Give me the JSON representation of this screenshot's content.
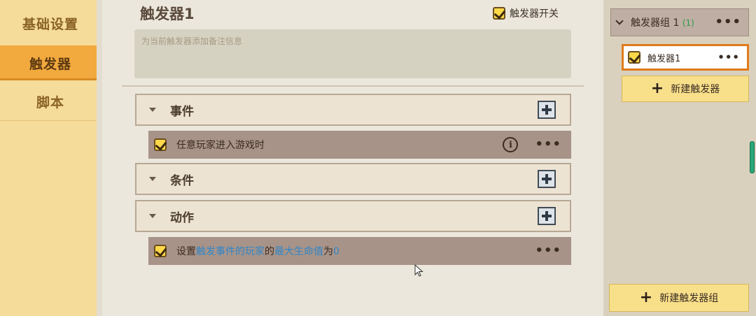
{
  "left_nav": {
    "items": [
      {
        "label": "基础设置",
        "active": false
      },
      {
        "label": "触发器",
        "active": true
      },
      {
        "label": "脚本",
        "active": false
      }
    ]
  },
  "editor": {
    "title": "触发器1",
    "switch_label": "触发器开关",
    "switch_checked": true,
    "note_placeholder": "为当前触发器添加备注信息",
    "sections": {
      "events": {
        "label": "事件"
      },
      "conditions": {
        "label": "条件"
      },
      "actions": {
        "label": "动作"
      }
    },
    "event_item": {
      "text": "任意玩家进入游戏时",
      "checked": true
    },
    "action_item": {
      "prefix": "设置",
      "param1": "触发事件的玩家",
      "mid": "的",
      "param2": "最大生命值",
      "suffix": "为",
      "param3": "0",
      "checked": true
    }
  },
  "right_panel": {
    "group": {
      "name": "触发器组 1",
      "count": "(1)"
    },
    "trigger_item": {
      "label": "触发器1",
      "checked": true
    },
    "new_trigger_label": "新建触发器",
    "new_group_label": "新建触发器组"
  },
  "colors": {
    "nav_bg": "#f6dc9a",
    "nav_active": "#f2a93e",
    "highlight_text": "#2f86c9",
    "selected_border": "#e07b1a",
    "button_yellow": "#f8df8a"
  }
}
